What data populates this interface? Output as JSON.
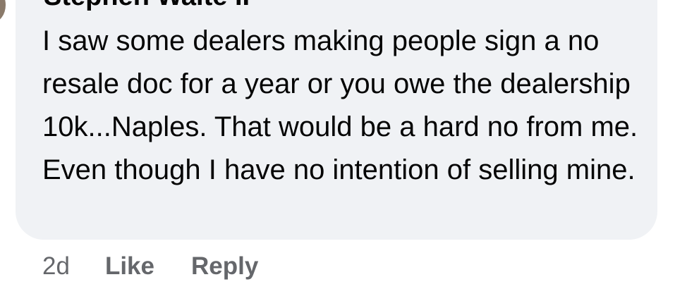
{
  "comment": {
    "author": "Stephen Waite II",
    "text": "I saw some dealers making people sign a no resale doc for a year or you owe the dealership 10k...Naples. That would be a hard no from me. Even though I have no intention of selling mine.",
    "timestamp": "2d",
    "like_label": "Like",
    "reply_label": "Reply"
  },
  "colors": {
    "bubble_bg": "#f0f2f5",
    "text": "#050505",
    "meta": "#65676b"
  }
}
